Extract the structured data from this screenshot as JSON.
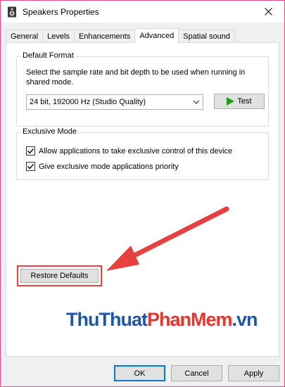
{
  "window": {
    "title": "Speakers Properties"
  },
  "tabs": [
    {
      "label": "General"
    },
    {
      "label": "Levels"
    },
    {
      "label": "Enhancements"
    },
    {
      "label": "Advanced"
    },
    {
      "label": "Spatial sound"
    }
  ],
  "default_format": {
    "label": "Default Format",
    "description": "Select the sample rate and bit depth to be used when running in shared mode.",
    "selected": "24 bit, 192000 Hz (Studio Quality)",
    "test_label": "Test"
  },
  "exclusive_mode": {
    "label": "Exclusive Mode",
    "allow_label": "Allow applications to take exclusive control of this device",
    "priority_label": "Give exclusive mode applications priority"
  },
  "restore_label": "Restore Defaults",
  "watermark": {
    "part1": "Thu",
    "part2": "Thuat",
    "part3": "PhanMem",
    "part4": ".vn"
  },
  "footer": {
    "ok": "OK",
    "cancel": "Cancel",
    "apply": "Apply"
  },
  "colors": {
    "highlight": "#e6413e",
    "accent": "#0078d7",
    "play": "#1e9c1e"
  }
}
